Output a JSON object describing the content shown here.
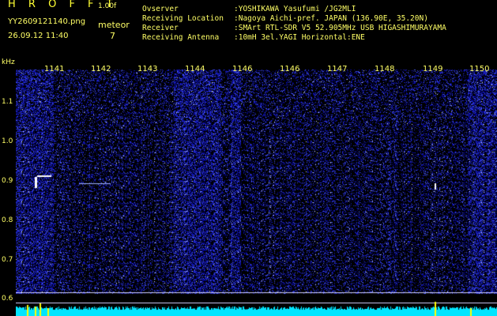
{
  "header": {
    "app_title": "H R O F F T",
    "app_version": "1.00f",
    "file_name": "YY2609121140.png",
    "date_time": "26.09.12 11:40",
    "meteor_label": "meteor",
    "meteor_count": "7"
  },
  "info": [
    {
      "key": "Ovserver",
      "value": ":YOSHIKAWA Yasufumi /JG2MLI"
    },
    {
      "key": "Receiving Location",
      "value": ":Nagoya Aichi-pref. JAPAN (136.90E, 35.20N)"
    },
    {
      "key": "Receiver",
      "value": ":SMArt RTL-SDR V5 52.905MHz USB HIGASHIMURAYAMA"
    },
    {
      "key": "Receiving Antenna",
      "value": ":10mH 3el.YAGI Horizontal:ENE"
    }
  ],
  "axes": {
    "unit": "kHz",
    "y_ticks": [
      "1.1",
      "1.0",
      "0.9",
      "0.8",
      "0.7",
      "0.6"
    ],
    "x_ticks": [
      "1141",
      "1142",
      "1143",
      "1144",
      "1146",
      "1146",
      "1147",
      "1148",
      "1149",
      "1150"
    ]
  },
  "colors": {
    "background": "#000000",
    "text": "#ffff66",
    "noise": "#1a2ad0",
    "signal": "#ffffff",
    "baseline": "#00e5ff",
    "spike": "#ffff00"
  }
}
